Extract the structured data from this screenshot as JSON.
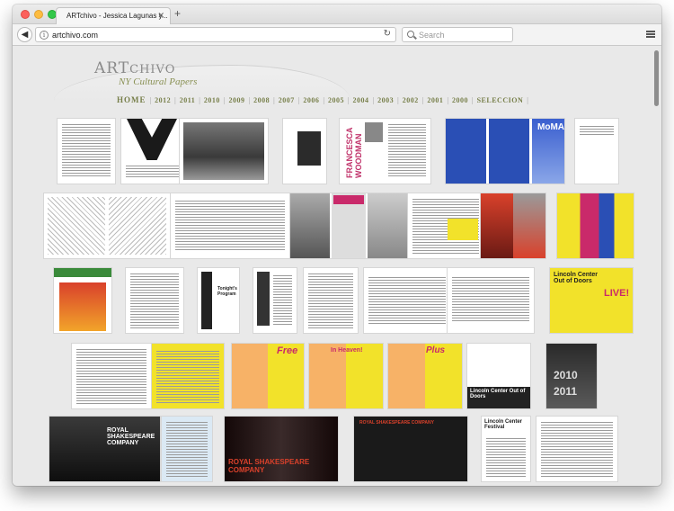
{
  "browser": {
    "tab_title": "ARTchivo - Jessica Lagunas y...",
    "tab_close": "✕",
    "new_tab": "+",
    "url": "artchivo.com",
    "search_placeholder": "Search",
    "back_glyph": "◀",
    "reload_glyph": "↻",
    "info_glyph": "i"
  },
  "site": {
    "logo_prefix": "ART",
    "logo_suffix": "CHIVO",
    "subtitle": "NY Cultural Papers",
    "nav": [
      "HOME",
      "2012",
      "2011",
      "2010",
      "2009",
      "2008",
      "2007",
      "2006",
      "2005",
      "2004",
      "2003",
      "2002",
      "2001",
      "2000",
      "SELECCION"
    ],
    "nav_separator": "|"
  },
  "thumbs": {
    "woodman_text": "FRANCESCA WOODMAN",
    "moma_text": "MoMA",
    "lincoln_text": "Lincoln Center Out of Doors",
    "lincoln_festival_text": "Lincoln Center Festival",
    "rsc_text": "ROYAL SHAKESPEARE COMPANY",
    "rsc_banner_text": "ROYAL SHAKESPEARE COMPANY",
    "free_text": "Free",
    "in_heaven_text": "In Heaven!",
    "plus_text": "Plus",
    "live_text": "LIVE!",
    "tonights_text": "Tonight's Program",
    "year_2010_text": "2010",
    "year_2011_text": "2011"
  },
  "colors": {
    "nav_olive": "#777f4a",
    "logo_gray": "#8a8a8a",
    "moma_blue": "#2a4fb5",
    "yellow": "#f2e22a",
    "magenta": "#c92a6a",
    "orange_red": "#d9412b"
  }
}
